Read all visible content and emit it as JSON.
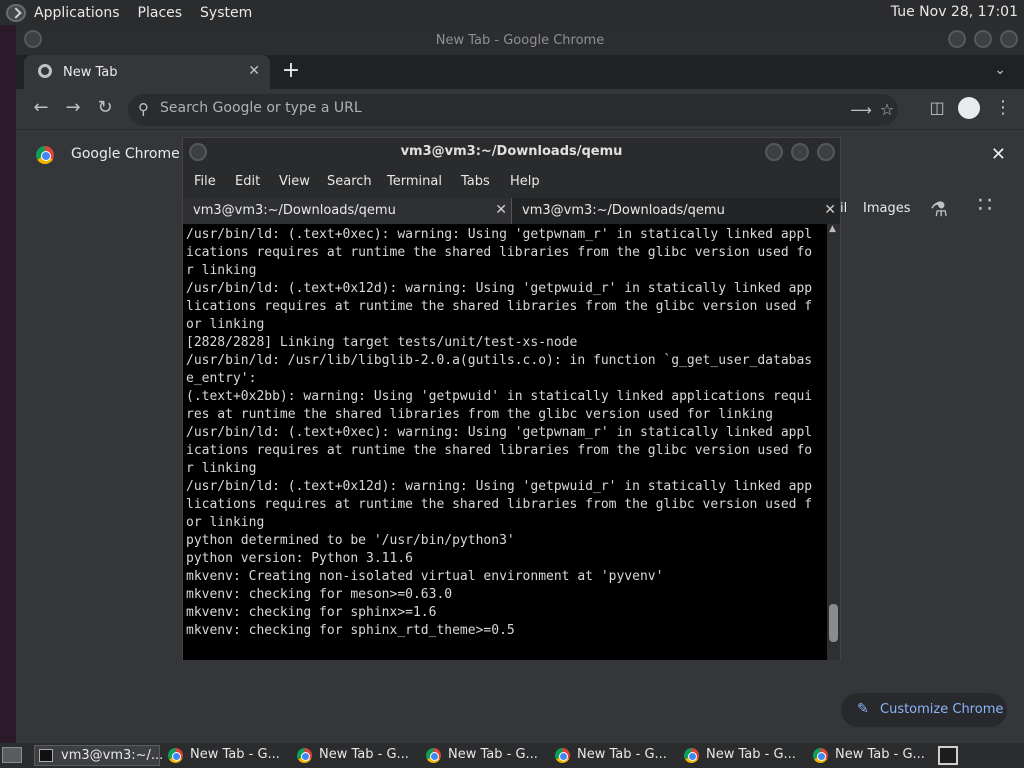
{
  "top_panel": {
    "menus": [
      "Applications",
      "Places",
      "System"
    ],
    "clock": "Tue Nov 28, 17:01"
  },
  "chrome": {
    "window_title": "New Tab - Google Chrome",
    "tab": {
      "label": "New Tab",
      "close": "✕"
    },
    "new_tab": "+",
    "omnibox_placeholder": "Search Google or type a URL",
    "infobar_text": "Google Chrome is",
    "infobar_close": "✕",
    "ntp_links": {
      "gmail_partial": "il",
      "images": "Images"
    },
    "customize_label": "Customize Chrome"
  },
  "terminal": {
    "title": "vm3@vm3:~/Downloads/qemu",
    "menus": [
      "File",
      "Edit",
      "View",
      "Search",
      "Terminal",
      "Tabs",
      "Help"
    ],
    "tabs": [
      {
        "label": "vm3@vm3:~/Downloads/qemu"
      },
      {
        "label": "vm3@vm3:~/Downloads/qemu"
      }
    ],
    "lines": [
      "/usr/bin/ld: (.text+0xec): warning: Using 'getpwnam_r' in statically linked appl",
      "ications requires at runtime the shared libraries from the glibc version used fo",
      "r linking",
      "/usr/bin/ld: (.text+0x12d): warning: Using 'getpwuid_r' in statically linked app",
      "lications requires at runtime the shared libraries from the glibc version used f",
      "or linking",
      "[2828/2828] Linking target tests/unit/test-xs-node",
      "/usr/bin/ld: /usr/lib/libglib-2.0.a(gutils.c.o): in function `g_get_user_databas",
      "e_entry':",
      "(.text+0x2bb): warning: Using 'getpwuid' in statically linked applications requi",
      "res at runtime the shared libraries from the glibc version used for linking",
      "/usr/bin/ld: (.text+0xec): warning: Using 'getpwnam_r' in statically linked appl",
      "ications requires at runtime the shared libraries from the glibc version used fo",
      "r linking",
      "/usr/bin/ld: (.text+0x12d): warning: Using 'getpwuid_r' in statically linked app",
      "lications requires at runtime the shared libraries from the glibc version used f",
      "or linking",
      "python determined to be '/usr/bin/python3'",
      "python version: Python 3.11.6",
      "mkvenv: Creating non-isolated virtual environment at 'pyvenv'",
      "mkvenv: checking for meson>=0.63.0",
      "mkvenv: checking for sphinx>=1.6",
      "mkvenv: checking for sphinx_rtd_theme>=0.5"
    ]
  },
  "taskbar": {
    "tasks": [
      "vm3@vm3:~/...",
      "New Tab - G...",
      "New Tab - G...",
      "New Tab - G...",
      "New Tab - G...",
      "New Tab - G...",
      "New Tab - G..."
    ]
  }
}
